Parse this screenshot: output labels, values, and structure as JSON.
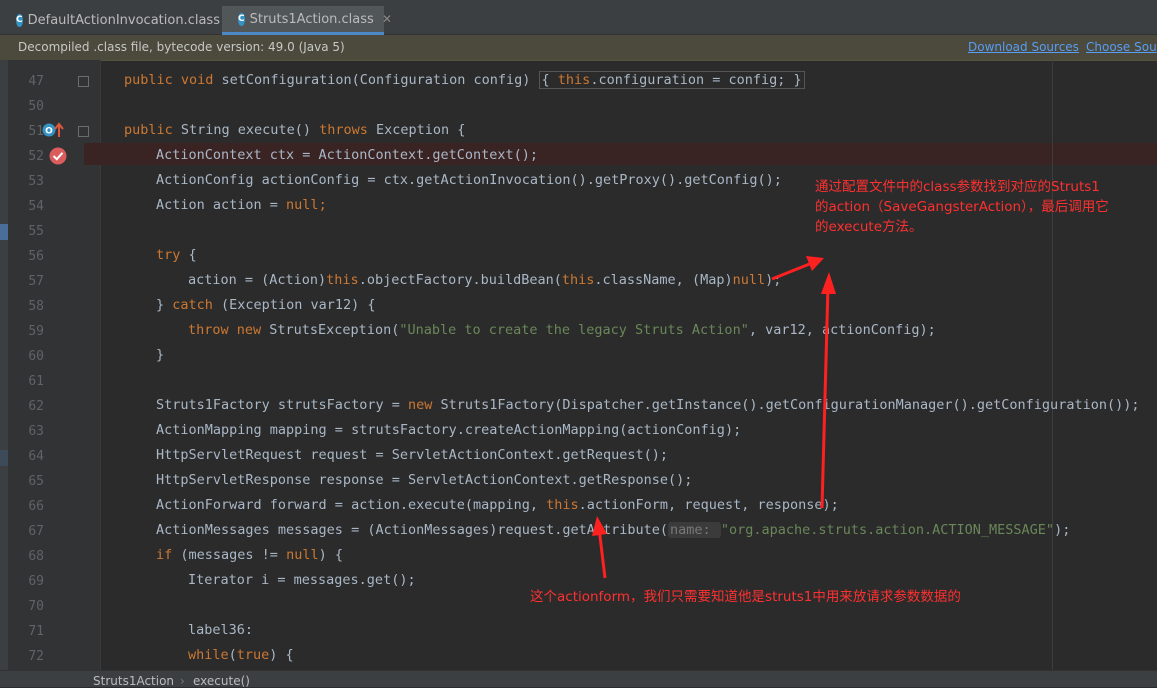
{
  "tabs": [
    {
      "label": "DefaultActionInvocation.class",
      "icon": "class-file-icon",
      "active": false
    },
    {
      "label": "Struts1Action.class",
      "icon": "class-file-icon",
      "active": true
    }
  ],
  "banner": {
    "message": "Decompiled .class file, bytecode version: 49.0 (Java 5)",
    "download_sources": "Download Sources",
    "choose_sources": "Choose Sou"
  },
  "code_lines": [
    {
      "n": "47"
    },
    {
      "n": "50"
    },
    {
      "n": "51"
    },
    {
      "n": "52"
    },
    {
      "n": "53"
    },
    {
      "n": "54"
    },
    {
      "n": "55"
    },
    {
      "n": "56"
    },
    {
      "n": "57"
    },
    {
      "n": "58"
    },
    {
      "n": "59"
    },
    {
      "n": "60"
    },
    {
      "n": "61"
    },
    {
      "n": "62"
    },
    {
      "n": "63"
    },
    {
      "n": "64"
    },
    {
      "n": "65"
    },
    {
      "n": "66"
    },
    {
      "n": "67"
    },
    {
      "n": "68"
    },
    {
      "n": "69"
    },
    {
      "n": "70"
    },
    {
      "n": "71"
    },
    {
      "n": "72"
    }
  ],
  "code": {
    "l47a": "public void ",
    "l47b": "setConfiguration(Configuration config) ",
    "l47c": "{ ",
    "l47d": "this",
    "l47e": ".configuration = config; }",
    "l51a": "public ",
    "l51b": "String execute() ",
    "l51c": "throws ",
    "l51d": "Exception {",
    "l52": "ActionContext ctx = ActionContext.getContext();",
    "l53": "ActionConfig actionConfig = ctx.getActionInvocation().getProxy().getConfig();",
    "l54a": "Action action = ",
    "l54b": "null",
    "l54c": ";",
    "l56a": "try ",
    "l56b": "{",
    "l57a": "action = (Action)",
    "l57b": "this",
    "l57c": ".objectFactory.buildBean(",
    "l57d": "this",
    "l57e": ".className, (Map)",
    "l57f": "null",
    "l57g": ");",
    "l58a": "} ",
    "l58b": "catch ",
    "l58c": "(Exception var12) {",
    "l59a": "throw new ",
    "l59b": "StrutsException(",
    "l59c": "\"Unable to create the legacy Struts Action\"",
    "l59d": ", var12, actionConfig);",
    "l60": "}",
    "l62a": "Struts1Factory strutsFactory = ",
    "l62b": "new ",
    "l62c": "Struts1Factory(Dispatcher.getInstance().getConfigurationManager().getConfiguration());",
    "l63": "ActionMapping mapping = strutsFactory.createActionMapping(actionConfig);",
    "l64": "HttpServletRequest request = ServletActionContext.getRequest();",
    "l65": "HttpServletResponse response = ServletActionContext.getResponse();",
    "l66a": "ActionForward forward = action.execute(mapping, ",
    "l66b": "this",
    "l66c": ".actionForm, request, response);",
    "l67a": "ActionMessages messages = (ActionMessages)request.getAttribute(",
    "l67b": "name: ",
    "l67c": "\"org.apache.struts.action.ACTION_MESSAGE\"",
    "l67d": ");",
    "l68a": "if ",
    "l68b": "(messages != ",
    "l68c": "null",
    "l68d": ") {",
    "l69": "Iterator i = messages.get();",
    "l71": "label36:",
    "l72a": "while",
    "l72b": "(",
    "l72c": "true",
    "l72d": ") {"
  },
  "annotations": {
    "top_line1": "通过配置文件中的class参数找到对应的Struts1",
    "top_line2": "的action（SaveGangsterAction），最后调用它",
    "top_line3": "的execute方法。",
    "bottom": "这个actionform，我们只需要知道他是struts1中用来放请求参数数据的"
  },
  "breadcrumb": {
    "class": "Struts1Action",
    "sep": "›",
    "method": "execute()"
  },
  "colors": {
    "keyword": "#cc7832",
    "string": "#6a8759",
    "text": "#a9b7c6",
    "annotation": "#ff3030",
    "link": "#589df6"
  }
}
